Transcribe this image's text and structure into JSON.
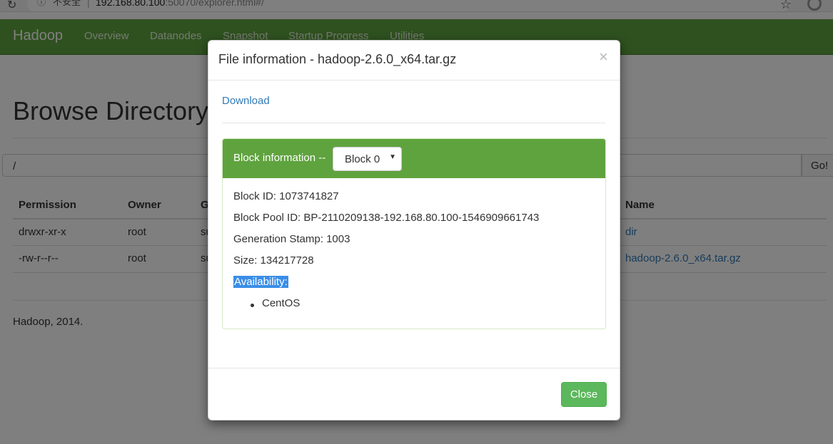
{
  "browser": {
    "insecure_label": "不安全",
    "url_host": "192.168.80.100",
    "url_rest": ":50070/explorer.html#/"
  },
  "navbar": {
    "brand": "Hadoop",
    "items": [
      "Overview",
      "Datanodes",
      "Snapshot",
      "Startup Progress",
      "Utilities"
    ]
  },
  "page": {
    "title": "Browse Directory",
    "path_value": "/",
    "go_label": "Go!",
    "footer": "Hadoop, 2014."
  },
  "table": {
    "columns": [
      "Permission",
      "Owner",
      "G",
      "Name"
    ],
    "rows": [
      {
        "permission": "drwxr-xr-x",
        "owner": "root",
        "group": "su",
        "name": "dir"
      },
      {
        "permission": "-rw-r--r--",
        "owner": "root",
        "group": "su",
        "name": "hadoop-2.6.0_x64.tar.gz"
      }
    ]
  },
  "modal": {
    "title": "File information - hadoop-2.6.0_x64.tar.gz",
    "close_x": "×",
    "download_label": "Download",
    "block_heading": "Block information --",
    "block_selected": "Block 0",
    "block_id": "Block ID: 1073741827",
    "block_pool_id": "Block Pool ID: BP-2110209138-192.168.80.100-1546909661743",
    "generation_stamp": "Generation Stamp: 1003",
    "size": "Size: 134217728",
    "availability_label": "Availability:",
    "nodes": [
      "CentOS"
    ],
    "close_button": "Close"
  }
}
